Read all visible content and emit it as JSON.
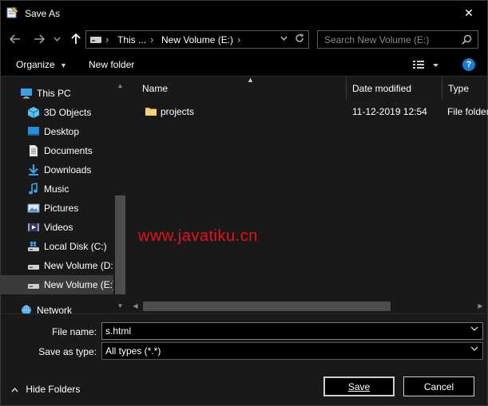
{
  "window": {
    "title": "Save As",
    "close_glyph": "✕"
  },
  "nav": {
    "address": {
      "crumb1": "This ...",
      "crumb2": "New Volume (E:)"
    },
    "search_placeholder": "Search New Volume (E:)"
  },
  "toolbar": {
    "organize": "Organize",
    "new_folder": "New folder",
    "help": "?"
  },
  "tree": {
    "items": [
      {
        "label": "This PC",
        "icon": "computer-icon"
      },
      {
        "label": "3D Objects",
        "icon": "cube-icon"
      },
      {
        "label": "Desktop",
        "icon": "desktop-icon"
      },
      {
        "label": "Documents",
        "icon": "document-icon"
      },
      {
        "label": "Downloads",
        "icon": "download-icon"
      },
      {
        "label": "Music",
        "icon": "music-icon"
      },
      {
        "label": "Pictures",
        "icon": "pictures-icon"
      },
      {
        "label": "Videos",
        "icon": "video-icon"
      },
      {
        "label": "Local Disk (C:)",
        "icon": "windows-drive-icon"
      },
      {
        "label": "New Volume (D:",
        "icon": "drive-icon"
      },
      {
        "label": "New Volume (E:)",
        "icon": "drive-icon",
        "selected": true
      },
      {
        "label": "Network",
        "icon": "network-icon"
      }
    ]
  },
  "files": {
    "columns": [
      "Name",
      "Date modified",
      "Type"
    ],
    "rows": [
      {
        "name": "projects",
        "date": "11-12-2019 12:54",
        "type": "File folder"
      }
    ]
  },
  "watermark": "www.javatiku.cn",
  "form": {
    "file_name_label": "File name:",
    "file_name_value": "s.html",
    "type_label": "Save as type:",
    "type_value": "All types (*.*)",
    "hide_folders": "Hide Folders",
    "save": "Save",
    "cancel": "Cancel"
  },
  "colors": {
    "accent": "#1a7ad4",
    "folder": "#e8c15a",
    "watermark": "#e8101a"
  }
}
